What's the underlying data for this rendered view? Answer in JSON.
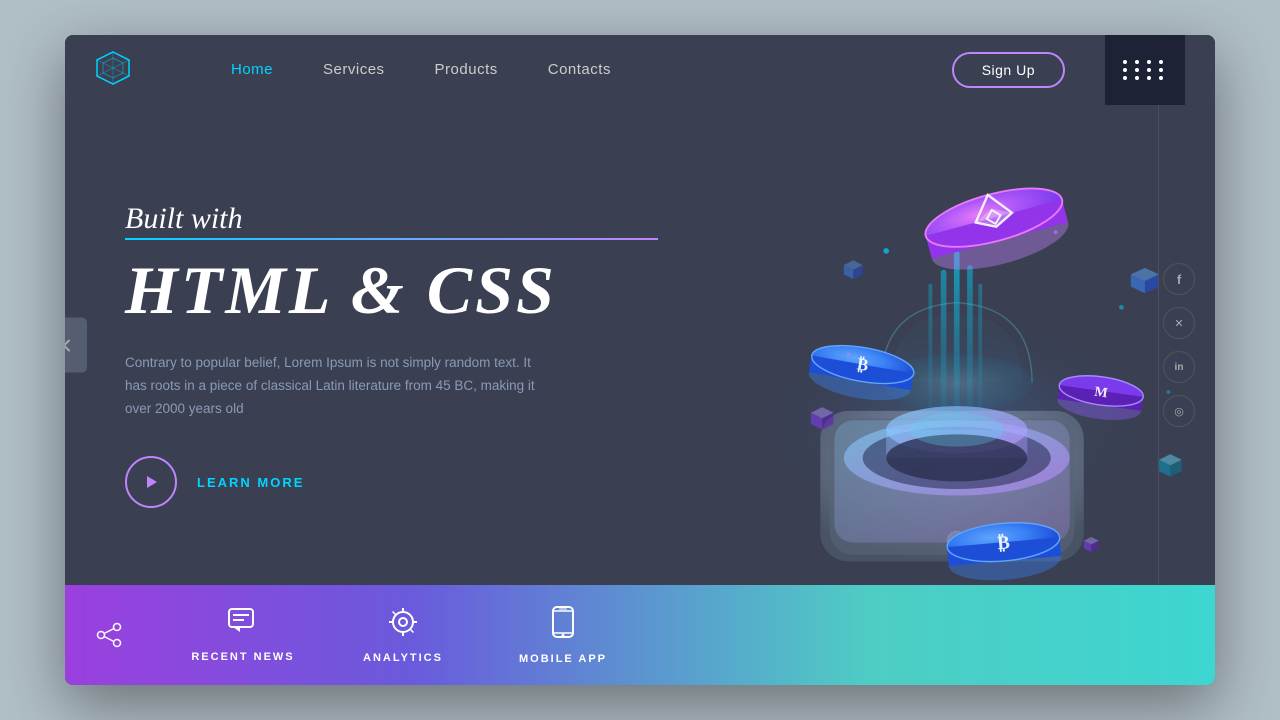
{
  "nav": {
    "links": [
      {
        "label": "Home",
        "active": true
      },
      {
        "label": "Services",
        "active": false
      },
      {
        "label": "Products",
        "active": false
      },
      {
        "label": "Contacts",
        "active": false
      }
    ],
    "signup_label": "Sign Up"
  },
  "hero": {
    "subtitle": "Built with",
    "title": "HTML & CSS",
    "description": "Contrary to popular belief, Lorem Ipsum is not simply random text. It has roots in a piece of classical Latin literature from 45 BC, making it over 2000 years old",
    "learn_more": "LEARN MORE"
  },
  "bottom_bar": {
    "items": [
      {
        "label": "RECENT NEWS",
        "icon": "💬"
      },
      {
        "label": "ANALYTICS",
        "icon": "⚙"
      },
      {
        "label": "MOBILE APP",
        "icon": "📱"
      }
    ]
  },
  "social": {
    "icons": [
      "f",
      "t",
      "in",
      "ig"
    ]
  },
  "colors": {
    "accent_cyan": "#00d4ff",
    "accent_purple": "#c084fc",
    "bg_dark": "#3a3f52",
    "bg_darker": "#1e2235"
  }
}
